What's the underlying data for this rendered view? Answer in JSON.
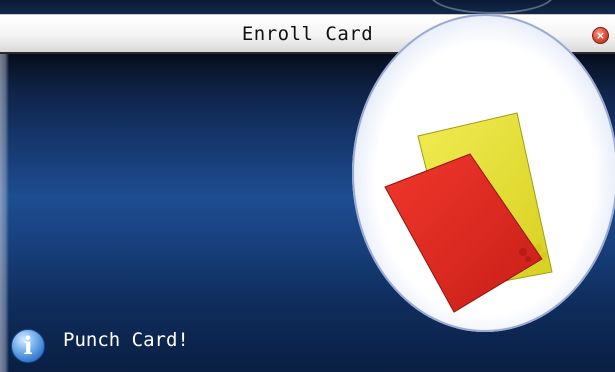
{
  "window": {
    "title": "Enroll Card"
  },
  "controls": {
    "close_icon": "close-icon",
    "close_glyph": "×"
  },
  "status": {
    "icon": "info-icon",
    "info_glyph": "i",
    "message": "Punch Card!"
  },
  "illustration": {
    "icon": "cards-icon",
    "front_card_color": "#e02b22",
    "back_card_color": "#e7e22f"
  },
  "colors": {
    "background": "#1e4d92",
    "titlebar": "#f4f4f4",
    "oval_glow": "#9fb0d8"
  }
}
